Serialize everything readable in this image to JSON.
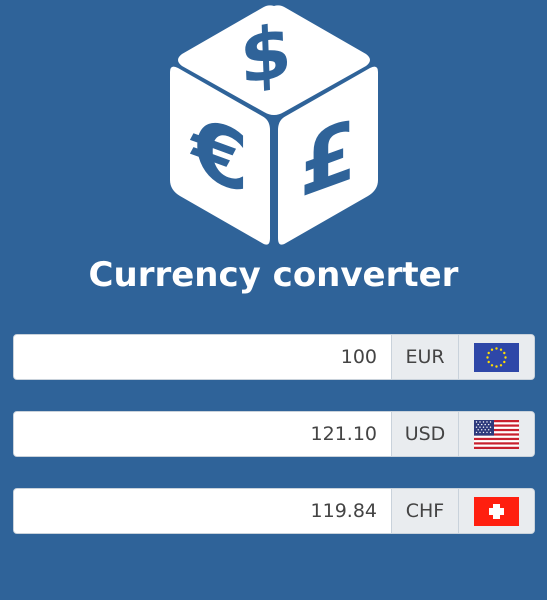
{
  "app": {
    "title": "Currency converter"
  },
  "colors": {
    "background": "#2f6399",
    "logo": "#ffffff",
    "field": "#ffffff",
    "addon": "#e9ecef"
  },
  "logo": {
    "icon": "currency-cube-icon",
    "symbols": [
      "$",
      "€",
      "£"
    ]
  },
  "currencies": [
    {
      "value": "100",
      "code": "EUR",
      "flag": "eu-flag-icon"
    },
    {
      "value": "121.10",
      "code": "USD",
      "flag": "us-flag-icon"
    },
    {
      "value": "119.84",
      "code": "CHF",
      "flag": "ch-flag-icon"
    }
  ]
}
